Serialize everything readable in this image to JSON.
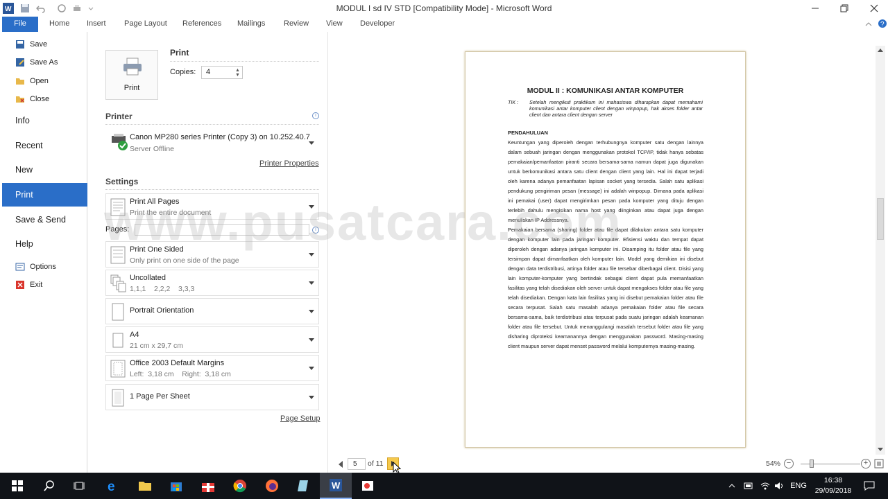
{
  "window": {
    "title": "MODUL I sd IV STD [Compatibility Mode] - Microsoft Word"
  },
  "ribbon": {
    "tabs": [
      {
        "id": "file",
        "label": "File"
      },
      {
        "id": "home",
        "label": "Home"
      },
      {
        "id": "insert",
        "label": "Insert"
      },
      {
        "id": "page-layout",
        "label": "Page Layout"
      },
      {
        "id": "references",
        "label": "References"
      },
      {
        "id": "mailings",
        "label": "Mailings"
      },
      {
        "id": "review",
        "label": "Review"
      },
      {
        "id": "view",
        "label": "View"
      },
      {
        "id": "developer",
        "label": "Developer"
      }
    ]
  },
  "nav": {
    "save": "Save",
    "save_as": "Save As",
    "open": "Open",
    "close": "Close",
    "info": "Info",
    "recent": "Recent",
    "new": "New",
    "print": "Print",
    "save_send": "Save & Send",
    "help": "Help",
    "options": "Options",
    "exit": "Exit"
  },
  "print": {
    "heading": "Print",
    "button_label": "Print",
    "copies_label": "Copies:",
    "copies_value": "4",
    "printer_heading": "Printer",
    "printer_name": "Canon MP280 series Printer (Copy 3) on 10.252.40.7",
    "printer_status": "Server Offline",
    "printer_properties": "Printer Properties",
    "settings_heading": "Settings",
    "pages_label": "Pages:",
    "pages_value": "",
    "page_setup": "Page Setup",
    "settings": {
      "range": {
        "main": "Print All Pages",
        "sub": "Print the entire document"
      },
      "sides": {
        "main": "Print One Sided",
        "sub": "Only print on one side of the page"
      },
      "collate": {
        "main": "Uncollated",
        "sub": "1,1,1    2,2,2    3,3,3"
      },
      "orientation": {
        "main": "Portrait Orientation"
      },
      "paper": {
        "main": "A4",
        "sub": "21 cm x 29,7 cm"
      },
      "margins": {
        "main": "Office 2003 Default Margins",
        "sub": "Left:  3,18 cm    Right:  3,18 cm"
      },
      "per_sheet": {
        "main": "1 Page Per Sheet"
      }
    }
  },
  "document": {
    "title": "MODUL II : KOMUNIKASI ANTAR KOMPUTER",
    "tik_label": "TIK  :",
    "tik_text": "Setelah mengikuti praktikum ini mahasiswa diharapkan dapat memahami komunikasi antar komputer client dengan winpopup, hak akses folder antar client dan antara client dengan server",
    "section": "PENDAHULUAN",
    "para1": "Keuntungan yang diperoleh dengan terhubungnya komputer satu dengan lainnya dalam sebuah jaringan dengan menggunakan protokol TCP/IP, tidak hanya sebatas pemakaian/pemanfaatan piranti secara bersama-sama namun dapat juga digunakan untuk berkomunikasi antara satu client dengan client yang lain. Hal ini dapat terjadi oleh karena adanya pemanfaatan lapisan socket yang tersedia. Salah satu aplikasi pendukung pengiriman pesan (message) ini adalah winpopup. Dimana pada aplikasi ini pemakai (user) dapat mengirimkan pesan pada komputer yang dituju dengan terlebih dahulu mengisikan nama host yang diinginkan atau dapat juga dengan menuliskan IP Addressnya.",
    "para2": "Pemakaian bersama (sharing) folder atau file dapat dilakukan antara satu komputer dengan komputer lain pada jaringan komputer. Efisiensi waktu dan tempat dapat diperoleh dengan adanya jaringan komputer ini. Disamping itu folder atau file yang tersimpan dapat dimanfaatkan oleh komputer lain. Model yang demikian ini disebut dengan data terdistribusi, artinya folder atau file tersebar diberbagai client. Disisi yang lain komputer-komputer yang bertindak sebagai client dapat pula memanfaatkan fasilitas yang telah disediakan oleh server untuk dapat mengakses folder atau file yang telah disediakan. Dengan kata lain fasilitas yang ini disebut pemakaian folder atau file secara terpusat. Salah satu masalah adanya pemakaian folder atau file secara bersama-sama, baik terdistribusi atau terpusat pada suatu jaringan adalah keamanan folder atau file tersebut. Untuk menanggulangi masalah tersebut folder atau file yang disharing diproteksi keamanannya dengan menggunakan password. Masing-masing client maupun server dapat menset password melalui komputernya masing-masing."
  },
  "watermark": "www.pusatcara.com",
  "pager": {
    "current": "5",
    "of_label": "of 11",
    "zoom": "54%"
  },
  "taskbar": {
    "lang": "ENG",
    "time": "16:38",
    "date": "29/09/2018"
  },
  "colors": {
    "accent": "#2a6ec8",
    "taskbar": "#101318"
  }
}
